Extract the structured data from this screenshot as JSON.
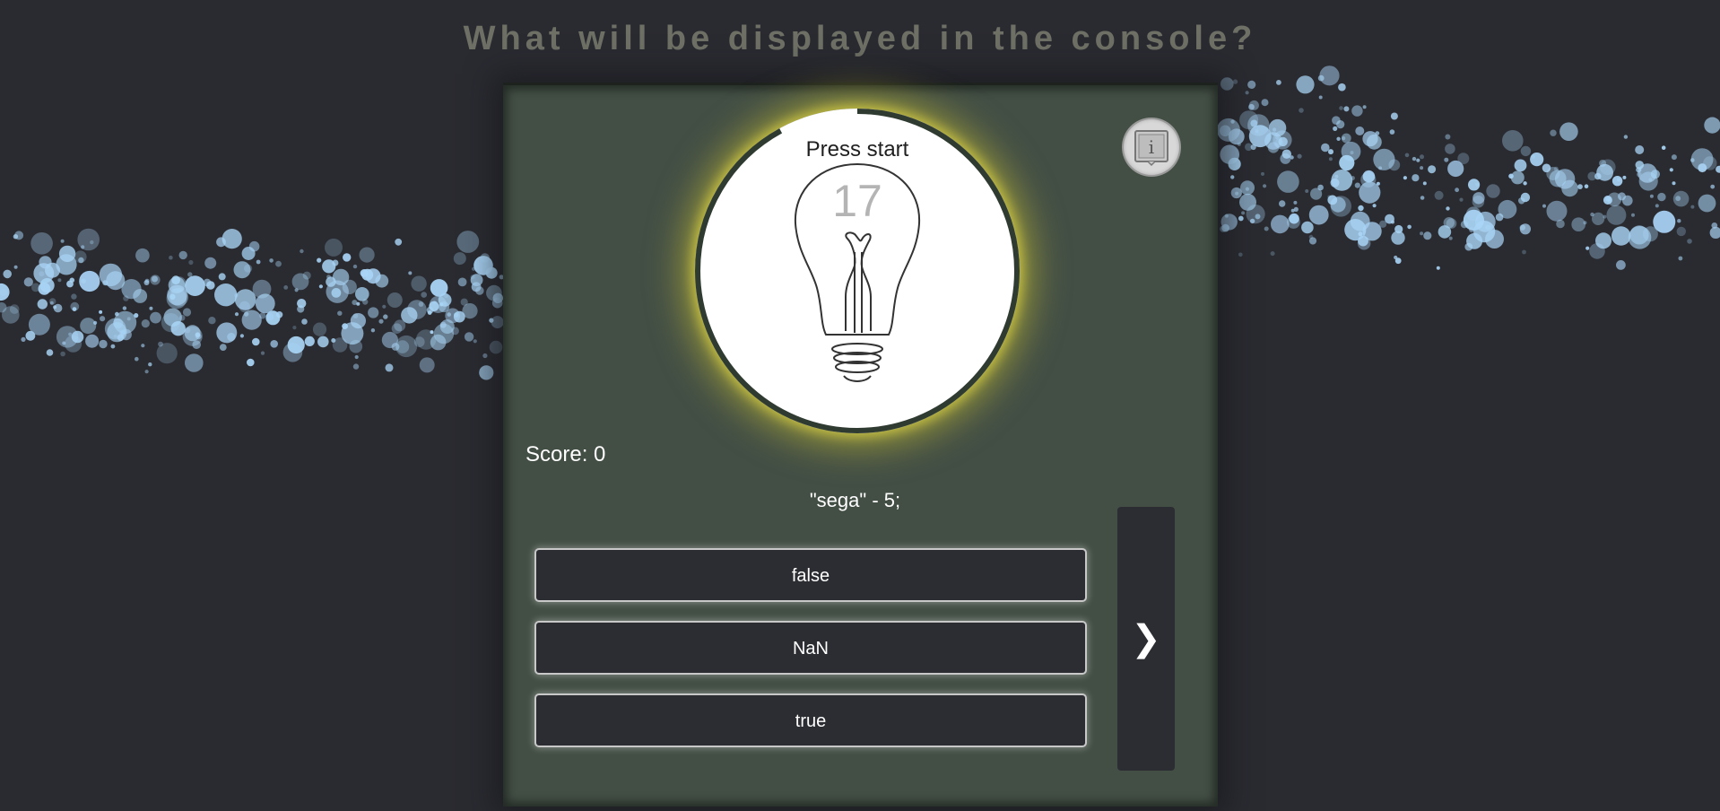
{
  "title": "What will be displayed in the console?",
  "timer": {
    "label": "Press start",
    "count": "17",
    "remaining_fraction": 0.92
  },
  "info_button": {
    "icon": "info-icon"
  },
  "score": {
    "label": "Score:",
    "value": "0"
  },
  "question": {
    "code": "\"sega\" - 5;"
  },
  "answers": [
    {
      "label": "false"
    },
    {
      "label": "NaN"
    },
    {
      "label": "true"
    }
  ],
  "next_button": {
    "icon": "chevron-right-icon",
    "glyph": "❯"
  },
  "colors": {
    "background": "#2a2b31",
    "panel": "#434f45",
    "button": "#2c2d32",
    "bulb_glow": "#e6d83a",
    "particles": "#a9d4f5"
  }
}
